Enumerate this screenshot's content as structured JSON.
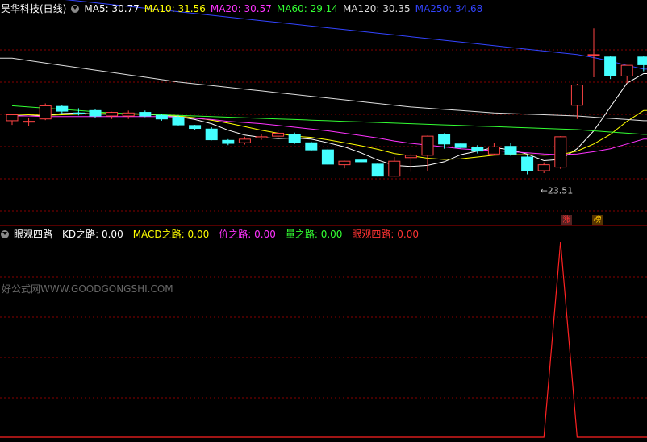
{
  "top_header": {
    "stock": "昊华科技(日线)",
    "indicators": [
      {
        "label": "MA5: 30.77",
        "color": "#ffffff"
      },
      {
        "label": "MA10: 31.56",
        "color": "#ffff00"
      },
      {
        "label": "MA20: 30.57",
        "color": "#ff33ff"
      },
      {
        "label": "MA60: 29.14",
        "color": "#33ff33"
      },
      {
        "label": "MA120: 30.35",
        "color": "#dddddd"
      },
      {
        "label": "MA250: 34.68",
        "color": "#3344ff"
      }
    ]
  },
  "bottom_header": {
    "name": "眼观四路",
    "items": [
      {
        "label": "KD之路: 0.00",
        "color": "#ffffff"
      },
      {
        "label": "MACD之路: 0.00",
        "color": "#ffff00"
      },
      {
        "label": "价之路: 0.00",
        "color": "#ff33ff"
      },
      {
        "label": "量之路: 0.00",
        "color": "#33ff33"
      },
      {
        "label": "眼观四路: 0.00",
        "color": "#ff3333"
      }
    ]
  },
  "watermark": "好公式网WWW.GOODGONGSHI.COM",
  "low_marker": "23.51",
  "tags": [
    {
      "text": "涨",
      "color": "#ff3333",
      "bg": "#552222"
    },
    {
      "text": "榜",
      "color": "#ffcc00",
      "bg": "#553300"
    }
  ],
  "colors": {
    "up": "#ff4444",
    "down": "#44ffff",
    "grid": "#880000",
    "signal": "#ff2222"
  },
  "chart_data": [
    {
      "type": "candlestick",
      "title": "昊华科技(日线)",
      "ylim": [
        22.5,
        39.0
      ],
      "candles": [
        [
          30.35,
          30.85,
          30.0,
          30.95
        ],
        [
          30.3,
          30.3,
          29.9,
          30.55
        ],
        [
          30.5,
          31.6,
          30.4,
          31.8
        ],
        [
          31.55,
          31.15,
          30.95,
          31.65
        ],
        [
          31.0,
          30.95,
          30.8,
          31.4
        ],
        [
          31.2,
          30.75,
          30.55,
          31.35
        ],
        [
          30.75,
          31.05,
          30.5,
          31.1
        ],
        [
          30.75,
          31.0,
          30.5,
          31.2
        ],
        [
          31.05,
          30.75,
          30.65,
          31.2
        ],
        [
          30.8,
          30.5,
          30.35,
          30.9
        ],
        [
          30.65,
          30.0,
          29.95,
          30.8
        ],
        [
          29.95,
          29.7,
          29.6,
          30.0
        ],
        [
          29.65,
          28.75,
          28.7,
          29.8
        ],
        [
          28.7,
          28.45,
          28.3,
          28.8
        ],
        [
          28.5,
          28.8,
          28.35,
          29.0
        ],
        [
          28.9,
          29.0,
          28.75,
          29.2
        ],
        [
          29.05,
          29.3,
          28.9,
          29.55
        ],
        [
          29.2,
          28.5,
          28.4,
          29.35
        ],
        [
          28.5,
          27.9,
          27.8,
          28.6
        ],
        [
          27.9,
          26.7,
          26.65,
          28.0
        ],
        [
          26.65,
          26.95,
          26.35,
          27.0
        ],
        [
          27.05,
          26.9,
          26.85,
          27.15
        ],
        [
          26.7,
          25.7,
          25.65,
          26.8
        ],
        [
          25.7,
          26.95,
          25.65,
          27.3
        ],
        [
          27.25,
          27.45,
          26.05,
          27.6
        ],
        [
          27.45,
          29.05,
          26.15,
          29.1
        ],
        [
          29.2,
          28.4,
          28.0,
          29.3
        ],
        [
          28.4,
          28.1,
          28.0,
          28.5
        ],
        [
          28.1,
          27.8,
          27.6,
          28.3
        ],
        [
          27.55,
          28.15,
          27.5,
          28.5
        ],
        [
          28.2,
          27.55,
          27.4,
          28.5
        ],
        [
          27.3,
          26.15,
          25.85,
          27.45
        ],
        [
          26.15,
          26.65,
          25.95,
          26.85
        ],
        [
          26.45,
          29.0,
          26.3,
          29.05
        ],
        [
          31.65,
          33.35,
          30.5,
          33.45
        ],
        [
          35.9,
          35.9,
          34.0,
          38.1
        ],
        [
          35.7,
          34.1,
          33.85,
          35.75
        ],
        [
          34.1,
          35.0,
          33.5,
          35.0
        ],
        [
          35.7,
          35.05,
          34.5,
          35.75
        ]
      ],
      "ma_series": [
        {
          "name": "MA5",
          "color": "#ffffff",
          "values": [
            30.8,
            30.75,
            30.8,
            30.95,
            31.0,
            30.9,
            30.9,
            30.95,
            30.9,
            30.8,
            30.7,
            30.45,
            30.1,
            29.55,
            29.15,
            28.95,
            28.85,
            28.9,
            28.8,
            28.5,
            28.15,
            27.65,
            27.05,
            26.6,
            26.5,
            26.6,
            26.9,
            27.5,
            27.8,
            28.1,
            27.9,
            27.55,
            27.0,
            27.1,
            28.0,
            29.5,
            31.5,
            33.5,
            34.3
          ]
        },
        {
          "name": "MA10",
          "color": "#ffff00",
          "values": [
            30.9,
            30.85,
            30.8,
            30.85,
            30.9,
            30.95,
            30.95,
            30.9,
            30.9,
            30.85,
            30.75,
            30.6,
            30.4,
            30.15,
            29.85,
            29.55,
            29.3,
            29.05,
            28.95,
            28.75,
            28.5,
            28.25,
            27.95,
            27.6,
            27.4,
            27.2,
            27.1,
            27.15,
            27.3,
            27.45,
            27.5,
            27.5,
            27.45,
            27.5,
            27.8,
            28.4,
            29.2,
            30.3,
            31.2
          ]
        },
        {
          "name": "MA20",
          "color": "#ff33ff",
          "values": [
            30.75,
            30.75,
            30.7,
            30.7,
            30.7,
            30.7,
            30.7,
            30.7,
            30.7,
            30.7,
            30.65,
            30.55,
            30.45,
            30.3,
            30.2,
            30.1,
            29.95,
            29.8,
            29.65,
            29.5,
            29.3,
            29.1,
            28.9,
            28.65,
            28.45,
            28.3,
            28.15,
            28.0,
            27.9,
            27.85,
            27.75,
            27.65,
            27.55,
            27.5,
            27.55,
            27.75,
            28.0,
            28.4,
            28.8
          ]
        },
        {
          "name": "MA60",
          "color": "#33ff33",
          "values": [
            31.6,
            31.5,
            31.4,
            31.3,
            31.2,
            31.1,
            31.0,
            30.95,
            30.9,
            30.85,
            30.8,
            30.75,
            30.7,
            30.65,
            30.6,
            30.55,
            30.5,
            30.45,
            30.4,
            30.35,
            30.3,
            30.25,
            30.2,
            30.15,
            30.1,
            30.05,
            30.0,
            29.95,
            29.9,
            29.85,
            29.8,
            29.75,
            29.7,
            29.65,
            29.6,
            29.5,
            29.4,
            29.3,
            29.2
          ]
        },
        {
          "name": "MA120",
          "color": "#dddddd",
          "values": [
            35.6,
            35.4,
            35.2,
            35.0,
            34.8,
            34.6,
            34.4,
            34.2,
            34.0,
            33.8,
            33.6,
            33.45,
            33.3,
            33.15,
            33.0,
            32.85,
            32.7,
            32.55,
            32.4,
            32.25,
            32.1,
            31.95,
            31.8,
            31.65,
            31.5,
            31.4,
            31.3,
            31.2,
            31.1,
            31.0,
            30.95,
            30.9,
            30.85,
            30.8,
            30.75,
            30.65,
            30.55,
            30.45,
            30.35
          ]
        },
        {
          "name": "MA250",
          "color": "#3344ff",
          "values": [
            41.0,
            40.85,
            40.7,
            40.55,
            40.4,
            40.25,
            40.1,
            39.95,
            39.8,
            39.65,
            39.5,
            39.35,
            39.2,
            39.05,
            38.9,
            38.75,
            38.6,
            38.45,
            38.3,
            38.15,
            38.0,
            37.85,
            37.7,
            37.55,
            37.4,
            37.25,
            37.1,
            36.95,
            36.8,
            36.65,
            36.5,
            36.35,
            36.2,
            36.05,
            35.9,
            35.65,
            35.35,
            35.0,
            34.68
          ]
        }
      ]
    },
    {
      "type": "line",
      "title": "眼观四路",
      "ylim": [
        0,
        1
      ],
      "series": [
        {
          "name": "眼观四路",
          "color": "#ff2222",
          "values": [
            0,
            0,
            0,
            0,
            0,
            0,
            0,
            0,
            0,
            0,
            0,
            0,
            0,
            0,
            0,
            0,
            0,
            0,
            0,
            0,
            0,
            0,
            0,
            0,
            0,
            0,
            0,
            0,
            0,
            0,
            0,
            0,
            0,
            1,
            0,
            0,
            0,
            0,
            0
          ]
        }
      ]
    }
  ]
}
